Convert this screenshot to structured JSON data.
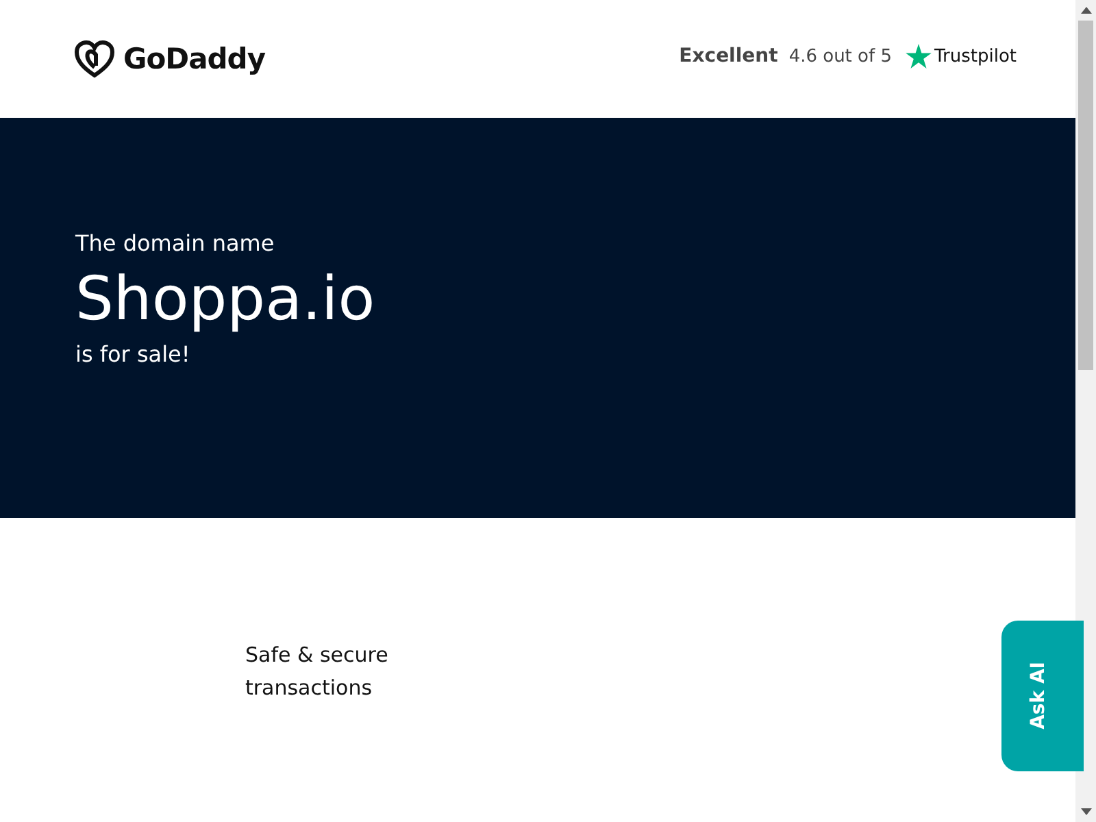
{
  "header": {
    "logo": "GoDaddy",
    "rating_word": "Excellent",
    "rating": "4.6 out of 5",
    "review_site": "Trustpilot"
  },
  "hero": {
    "intro": "The domain name",
    "domain": "Shoppa.io",
    "outro": "is for sale!"
  },
  "features": [
    {
      "text": "Safe & secure transactions"
    }
  ],
  "ask_button": "Ask AI"
}
